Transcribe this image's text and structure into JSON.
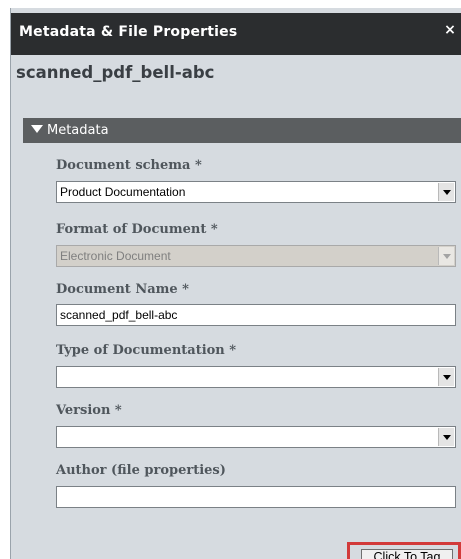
{
  "dialog": {
    "title": "Metadata & File Properties",
    "close_label": "×",
    "filename": "scanned_pdf_bell-abc"
  },
  "section": {
    "label": "Metadata"
  },
  "fields": {
    "document_schema": {
      "label": "Document schema *",
      "value": "Product Documentation"
    },
    "format_of_document": {
      "label": "Format of Document *",
      "value": "Electronic Document"
    },
    "document_name": {
      "label": "Document Name *",
      "value": "scanned_pdf_bell-abc"
    },
    "type_of_documentation": {
      "label": "Type of Documentation *",
      "value": ""
    },
    "version": {
      "label": "Version *",
      "value": ""
    },
    "author": {
      "label": "Author (file properties)",
      "value": ""
    }
  },
  "actions": {
    "click_to_tag_label": "Click To Tag"
  },
  "colors": {
    "titlebar": "#2b2d2f",
    "panel": "#d6dbe0",
    "section_header": "#5b5e60",
    "highlight": "#d23a3a"
  }
}
